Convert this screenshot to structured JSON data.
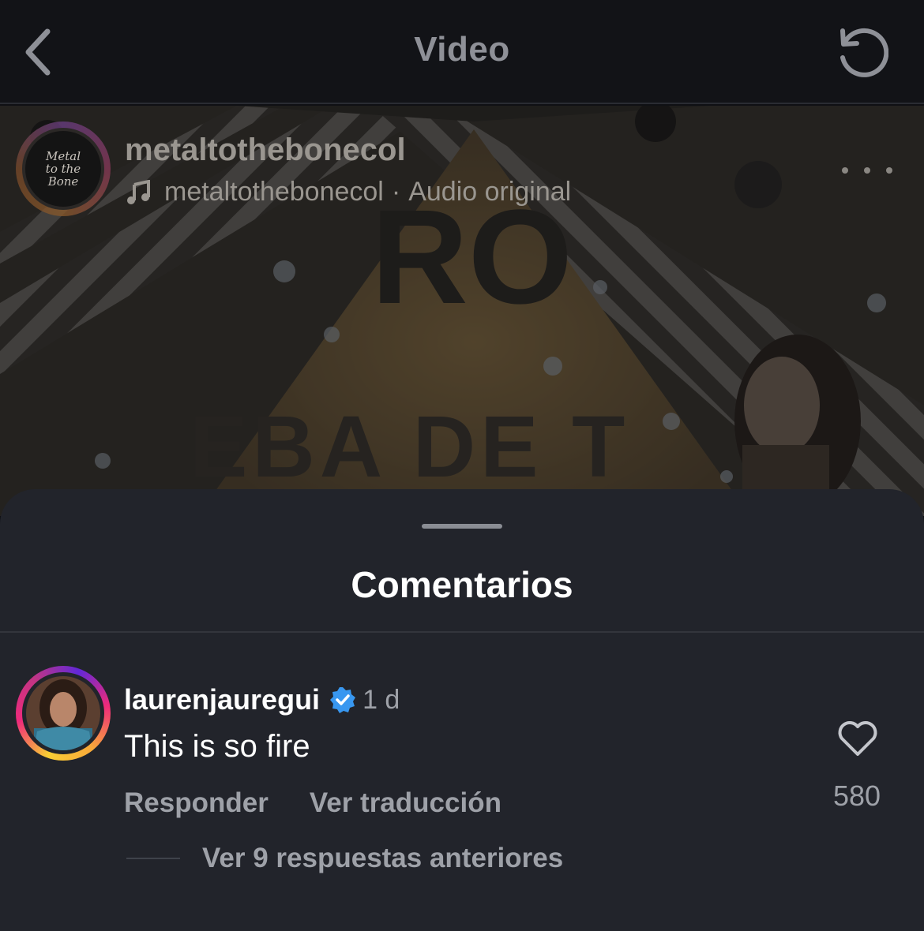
{
  "header": {
    "title": "Video"
  },
  "post": {
    "username": "metaltothebonecol",
    "audio_account": "metaltothebonecol",
    "audio_separator": "·",
    "audio_label": "Audio original",
    "avatar_text": [
      "Metal",
      "to the",
      "Bone"
    ]
  },
  "comments_sheet": {
    "title": "Comentarios",
    "comment": {
      "username": "laurenjauregui",
      "time": "1 d",
      "text": "This is so fire",
      "reply_label": "Responder",
      "translate_label": "Ver traducción",
      "like_count": "580"
    },
    "view_replies_label": "Ver 9 respuestas anteriores"
  },
  "colors": {
    "verified": "#3897f0",
    "sheet_bg": "#22242b",
    "topbar_bg": "#121317"
  },
  "icons": {
    "back": "chevron-left-icon",
    "replay": "replay-icon",
    "music": "music-note-icon",
    "more": "more-horizontal-icon",
    "verified": "verified-badge-icon",
    "like": "heart-outline-icon"
  }
}
